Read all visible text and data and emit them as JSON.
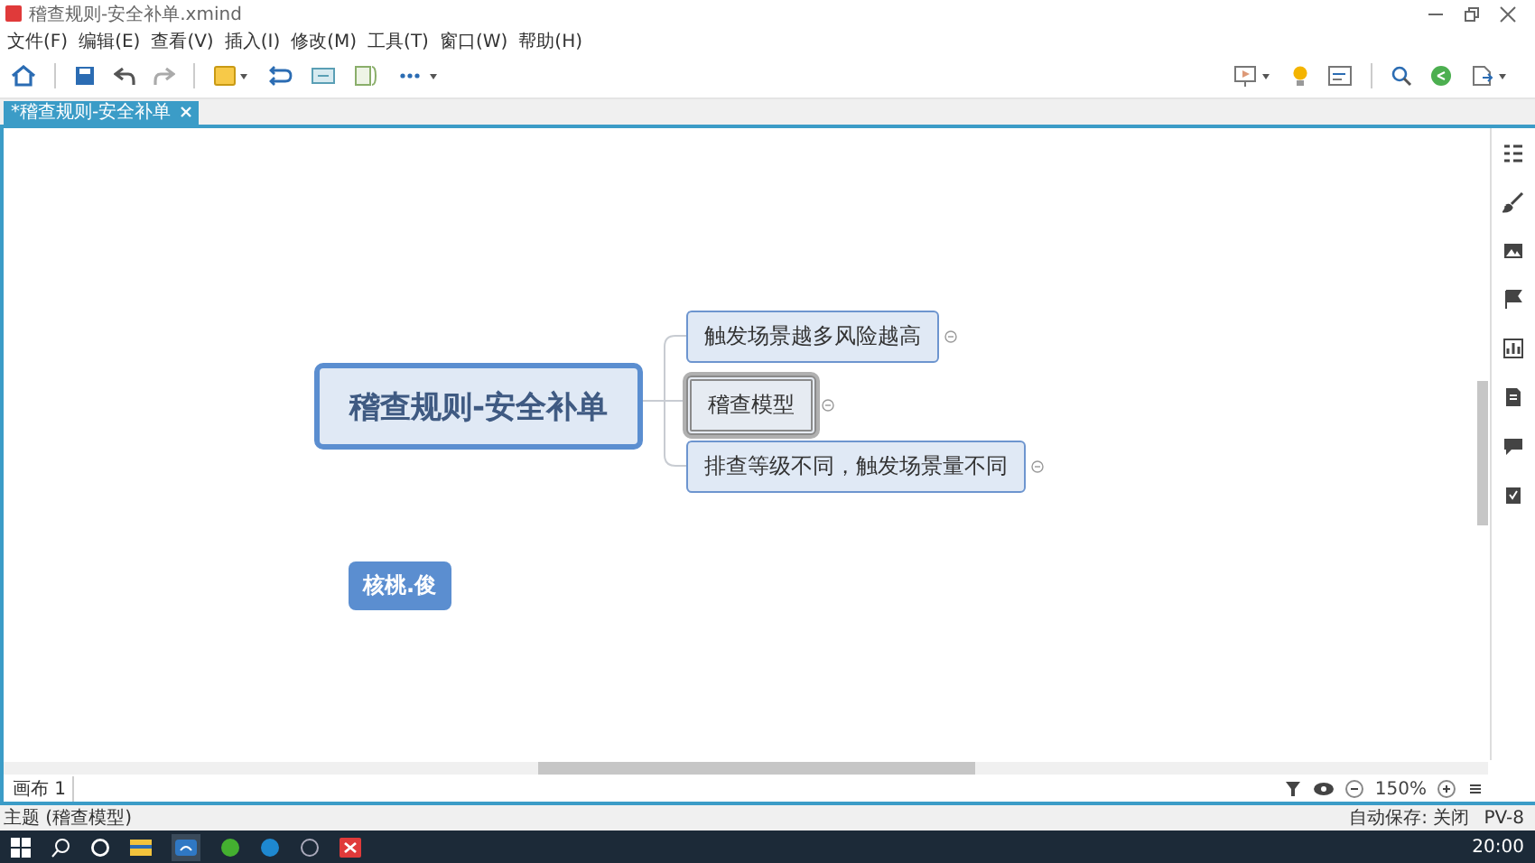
{
  "window": {
    "title": "稽查规则-安全补单.xmind"
  },
  "menu": [
    "文件(F)",
    "编辑(E)",
    "查看(V)",
    "插入(I)",
    "修改(M)",
    "工具(T)",
    "窗口(W)",
    "帮助(H)"
  ],
  "tabs": [
    {
      "label": "*稽查规则-安全补单",
      "selected": true
    }
  ],
  "mindmap": {
    "central": "稽查规则-安全补单",
    "branches": [
      {
        "label": "触发场景越多风险越高",
        "selected": false
      },
      {
        "label": "稽查模型",
        "selected": true
      },
      {
        "label": "排查等级不同，触发场景量不同",
        "selected": false
      }
    ],
    "floating": "核桃.俊"
  },
  "sheet_tabs": [
    {
      "label": "画布 1",
      "selected": true
    }
  ],
  "zoom": "150%",
  "status_bar": {
    "topic": "主题 (稽查模型)",
    "autosave": "自动保存: 关闭",
    "version": "PV-8"
  },
  "taskbar": {
    "clock": "20:00"
  }
}
